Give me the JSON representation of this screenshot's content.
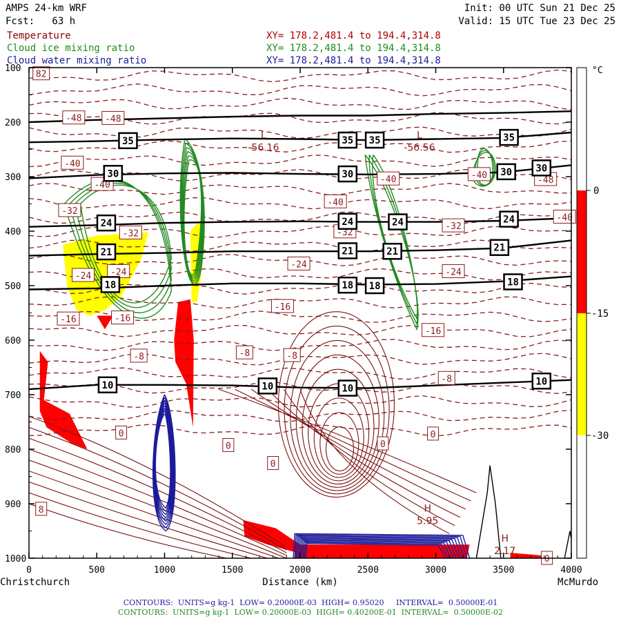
{
  "header": {
    "model": "AMPS 24-km WRF",
    "forecast": "Fcst:   63 h",
    "init": "Init: 00 UTC Sun 21 Dec 25",
    "valid": "Valid: 15 UTC Tue 23 Dec 25"
  },
  "variables": [
    {
      "name": "Temperature",
      "xy": "XY= 178.2,481.4 to 194.4,314.8",
      "color": "#8b0000"
    },
    {
      "name": "Cloud ice mixing ratio",
      "xy": "XY= 178.2,481.4 to 194.4,314.8",
      "color": "#1f8b1f"
    },
    {
      "name": "Cloud water mixing ratio",
      "xy": "XY= 178.2,481.4 to 194.4,314.8",
      "color": "#1c1c9a"
    }
  ],
  "footer": [
    {
      "text": "CONTOURS:  UNITS=g kg-1  LOW= 0.20000E-03  HIGH= 0.95020     INTERVAL=  0.50000E-01",
      "color": "#1c1c9a"
    },
    {
      "text": "CONTOURS:  UNITS=g kg-1  LOW= 0.20000E-03  HIGH= 0.40200E-01  INTERVAL=  0.50000E-02",
      "color": "#1f8b1f"
    }
  ],
  "chart_data": {
    "type": "cross-section",
    "xlabel": "Distance (km)",
    "x_endpoints": {
      "left": "Christchurch",
      "right": "McMurdo"
    },
    "x_ticks": [
      0,
      500,
      1000,
      1500,
      2000,
      2500,
      3000,
      3500,
      4000
    ],
    "xlim": [
      0,
      4000
    ],
    "y_ticks": [
      100,
      200,
      300,
      400,
      500,
      600,
      700,
      800,
      900,
      1000
    ],
    "ylim": [
      1000,
      100
    ],
    "colorbar": {
      "unit": "°C",
      "labels": [
        0,
        -15,
        -30
      ],
      "bands": [
        {
          "range": "above 0",
          "color": "#ffffff"
        },
        {
          "range": "0 to -15",
          "color": "#ff0000"
        },
        {
          "range": "-15 to -30",
          "color": "#ffff00"
        },
        {
          "range": "below -30",
          "color": "#ffffff"
        }
      ]
    },
    "isentropes": [
      {
        "label": "10",
        "points": [
          [
            0,
            690
          ],
          [
            500,
            682
          ],
          [
            1000,
            682
          ],
          [
            1500,
            683
          ],
          [
            2000,
            687
          ],
          [
            2500,
            688
          ],
          [
            3000,
            683
          ],
          [
            3500,
            678
          ],
          [
            4000,
            673
          ]
        ],
        "labels_at": [
          [
            580,
            682
          ],
          [
            1760,
            684
          ],
          [
            2350,
            688
          ],
          [
            3780,
            675
          ]
        ]
      },
      {
        "label": "18",
        "points": [
          [
            0,
            507
          ],
          [
            500,
            505
          ],
          [
            1000,
            500
          ],
          [
            1500,
            496
          ],
          [
            2000,
            496
          ],
          [
            2500,
            498
          ],
          [
            3000,
            497
          ],
          [
            3500,
            492
          ],
          [
            4000,
            483
          ]
        ],
        "labels_at": [
          [
            600,
            498
          ],
          [
            2350,
            499
          ],
          [
            2550,
            500
          ],
          [
            3570,
            493
          ]
        ]
      },
      {
        "label": "21",
        "points": [
          [
            0,
            445
          ],
          [
            500,
            442
          ],
          [
            1000,
            440
          ],
          [
            1500,
            437
          ],
          [
            2000,
            437
          ],
          [
            2500,
            437
          ],
          [
            3000,
            435
          ],
          [
            3500,
            431
          ],
          [
            4000,
            417
          ]
        ],
        "labels_at": [
          [
            570,
            438
          ],
          [
            2350,
            436
          ],
          [
            2680,
            437
          ],
          [
            3470,
            430
          ]
        ]
      },
      {
        "label": "24",
        "points": [
          [
            0,
            392
          ],
          [
            500,
            389
          ],
          [
            1000,
            385
          ],
          [
            1500,
            383
          ],
          [
            2000,
            382
          ],
          [
            2500,
            383
          ],
          [
            3000,
            383
          ],
          [
            3500,
            381
          ],
          [
            4000,
            376
          ]
        ],
        "labels_at": [
          [
            570,
            385
          ],
          [
            2350,
            382
          ],
          [
            2720,
            383
          ],
          [
            3540,
            378
          ]
        ]
      },
      {
        "label": "30",
        "points": [
          [
            0,
            303
          ],
          [
            500,
            297
          ],
          [
            1000,
            294
          ],
          [
            1500,
            293
          ],
          [
            2000,
            295
          ],
          [
            2500,
            296
          ],
          [
            3000,
            295
          ],
          [
            3500,
            292
          ],
          [
            4000,
            279
          ]
        ],
        "labels_at": [
          [
            620,
            294
          ],
          [
            2350,
            295
          ],
          [
            3520,
            291
          ],
          [
            3780,
            284
          ]
        ]
      },
      {
        "label": "35",
        "points": [
          [
            0,
            237
          ],
          [
            500,
            235
          ],
          [
            1000,
            232
          ],
          [
            1500,
            230
          ],
          [
            2000,
            231
          ],
          [
            2500,
            233
          ],
          [
            3000,
            231
          ],
          [
            3500,
            229
          ],
          [
            4000,
            219
          ]
        ],
        "labels_at": [
          [
            730,
            234
          ],
          [
            2350,
            233
          ],
          [
            2550,
            233
          ],
          [
            3540,
            228
          ]
        ]
      },
      {
        "label": "",
        "points": [
          [
            0,
            200
          ],
          [
            500,
            196
          ],
          [
            1000,
            193
          ],
          [
            1500,
            190
          ],
          [
            2000,
            188
          ],
          [
            2500,
            188
          ],
          [
            3000,
            185
          ],
          [
            3500,
            183
          ],
          [
            4000,
            180
          ]
        ],
        "labels_at": []
      }
    ],
    "temperature_labels": [
      {
        "v": "82",
        "x": 90,
        "y": 111
      },
      {
        "v": "-48",
        "x": 330,
        "y": 192
      },
      {
        "v": "-48",
        "x": 620,
        "y": 193
      },
      {
        "v": "-40",
        "x": 320,
        "y": 275
      },
      {
        "v": "-40",
        "x": 540,
        "y": 314
      },
      {
        "v": "-40",
        "x": 2260,
        "y": 346
      },
      {
        "v": "-40",
        "x": 2650,
        "y": 304
      },
      {
        "v": "-40",
        "x": 3320,
        "y": 296
      },
      {
        "v": "-48",
        "x": 3810,
        "y": 305
      },
      {
        "v": "-40",
        "x": 3950,
        "y": 374
      },
      {
        "v": "-32",
        "x": 300,
        "y": 362
      },
      {
        "v": "-32",
        "x": 750,
        "y": 403
      },
      {
        "v": "-32",
        "x": 2330,
        "y": 401
      },
      {
        "v": "-32",
        "x": 3130,
        "y": 390
      },
      {
        "v": "-24",
        "x": 400,
        "y": 481
      },
      {
        "v": "-24",
        "x": 660,
        "y": 474
      },
      {
        "v": "-24",
        "x": 1990,
        "y": 460
      },
      {
        "v": "-24",
        "x": 3130,
        "y": 474
      },
      {
        "v": "-16",
        "x": 290,
        "y": 561
      },
      {
        "v": "-16",
        "x": 690,
        "y": 559
      },
      {
        "v": "-16",
        "x": 1870,
        "y": 538
      },
      {
        "v": "-16",
        "x": 2980,
        "y": 582
      },
      {
        "v": "-8",
        "x": 810,
        "y": 629
      },
      {
        "v": "-8",
        "x": 1590,
        "y": 623
      },
      {
        "v": "-8",
        "x": 1940,
        "y": 628
      },
      {
        "v": "-8",
        "x": 3080,
        "y": 670
      },
      {
        "v": "0",
        "x": 680,
        "y": 770
      },
      {
        "v": "0",
        "x": 1470,
        "y": 793
      },
      {
        "v": "0",
        "x": 1800,
        "y": 826
      },
      {
        "v": "0",
        "x": 2610,
        "y": 790
      },
      {
        "v": "0",
        "x": 2980,
        "y": 772
      },
      {
        "v": "8",
        "x": 90,
        "y": 910
      },
      {
        "v": "0",
        "x": 3820,
        "y": 1000
      }
    ],
    "extrema": [
      {
        "kind": "L",
        "value": "-56.16",
        "x": 1730,
        "y": 245
      },
      {
        "kind": "L",
        "value": "-56.56",
        "x": 2880,
        "y": 245
      },
      {
        "kind": "H",
        "value": "5.95",
        "x": 2940,
        "y": 930
      },
      {
        "kind": "H",
        "value": "2.17",
        "x": 3510,
        "y": 985
      }
    ],
    "terrain_peak": {
      "x": 3400,
      "elev_hpa": 830
    }
  }
}
